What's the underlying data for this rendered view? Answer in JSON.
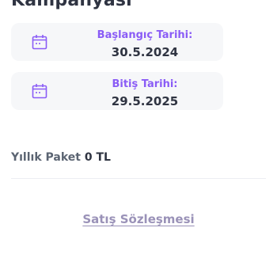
{
  "header": {
    "title": "Kampanyası"
  },
  "subscription": {
    "start": {
      "label": "Başlangıç Tarihi:",
      "value": "30.5.2024",
      "icon": "calendar-icon"
    },
    "end": {
      "label": "Bitiş Tarihi:",
      "value": "29.5.2025",
      "icon": "calendar-icon"
    }
  },
  "price": {
    "label": "Yıllık Paket",
    "value": "0 TL"
  },
  "links": {
    "contract": "Satış Sözleşmesi"
  },
  "colors": {
    "accent": "#8a5cf6",
    "text_dark": "#2f3442",
    "link": "#9a92b8",
    "card_bg": "#f6f7f9"
  }
}
